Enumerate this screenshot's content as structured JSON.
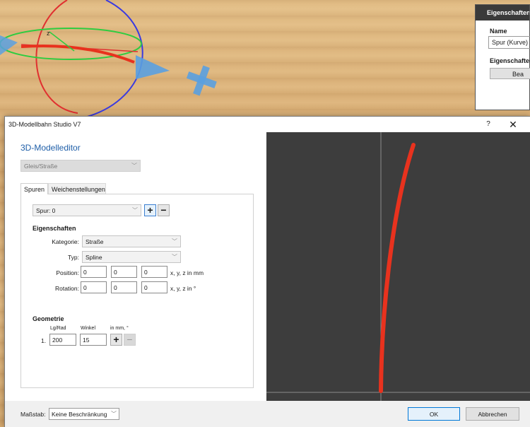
{
  "properties_panel": {
    "title": "Eigenschaften",
    "name_label": "Name",
    "name_value": "Spur (Kurve)",
    "section_label": "Eigenschaften",
    "button_label": "Bea"
  },
  "dialog": {
    "title": "3D-Modellbahn Studio V7",
    "help_glyph": "?",
    "close_glyph": "✕",
    "heading": "3D-Modelleditor",
    "category_select": "Gleis/Straße",
    "tabs": [
      {
        "label": "Spuren",
        "active": true
      },
      {
        "label": "Weichenstellungen",
        "active": false
      }
    ],
    "track_select": "Spur: 0",
    "add_glyph": "+",
    "remove_glyph": "−",
    "properties": {
      "heading": "Eigenschaften",
      "kategorie_label": "Kategorie:",
      "kategorie_value": "Straße",
      "typ_label": "Typ:",
      "typ_value": "Spline",
      "position_label": "Position:",
      "position_values": [
        "0",
        "0",
        "0"
      ],
      "position_unit": "x, y, z in mm",
      "rotation_label": "Rotation:",
      "rotation_values": [
        "0",
        "0",
        "0"
      ],
      "rotation_unit": "x, y, z in °"
    },
    "geometry": {
      "heading": "Geometrie",
      "col_length": "Lg/Rad",
      "col_angle": "Winkel",
      "col_unit": "in mm, °",
      "rows": [
        {
          "index": "1.",
          "length": "200",
          "angle": "15"
        }
      ]
    },
    "footer": {
      "scale_label": "Maßstab:",
      "scale_value": "Keine Beschränkung",
      "ok_label": "OK",
      "cancel_label": "Abbrechen"
    }
  },
  "colors": {
    "accent_heading": "#1e5ea8",
    "preview_bg": "#3d3d3d",
    "track_curve": "#e8321e"
  },
  "icons": {
    "chevron": "chevron-down-icon",
    "close": "close-icon"
  }
}
